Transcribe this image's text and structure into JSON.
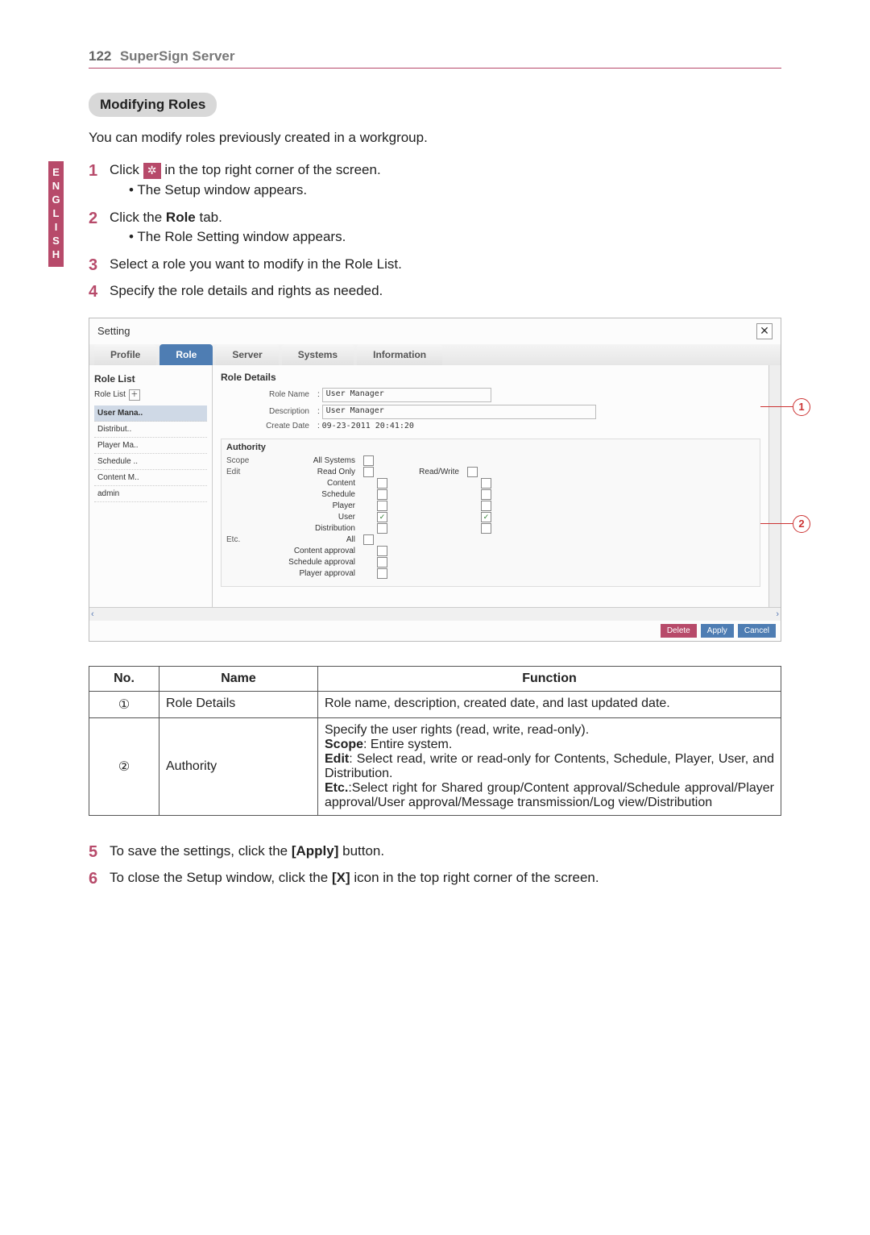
{
  "header": {
    "page_num": "122",
    "title": "SuperSign Server"
  },
  "side_tab": "ENGLISH",
  "section_title": "Modifying Roles",
  "intro": "You can modify roles previously created in a workgroup.",
  "steps": {
    "s1_a": "Click",
    "s1_b": "in the top right corner of the screen.",
    "s1_bullet": "The Setup window appears.",
    "s2": "Click the ",
    "s2_bold": "Role",
    "s2_tail": " tab.",
    "s2_bullet": "The Role Setting window appears.",
    "s3": "Select a role you want to modify in the Role List.",
    "s4": "Specify the role details and rights as needed.",
    "s5_a": "To save the settings, click the ",
    "s5_bold": "[Apply]",
    "s5_b": " button.",
    "s6_a": "To close the Setup window, click the ",
    "s6_bold": "[X]",
    "s6_b": " icon in the top right corner of the screen."
  },
  "nums": {
    "1": "1",
    "2": "2",
    "3": "3",
    "4": "4",
    "5": "5",
    "6": "6"
  },
  "setting": {
    "title": "Setting",
    "tabs": {
      "profile": "Profile",
      "role": "Role",
      "server": "Server",
      "systems": "Systems",
      "information": "Information"
    },
    "role_list": {
      "header": "Role List",
      "label": "Role List",
      "items": [
        "User Mana..",
        "Distribut..",
        "Player Ma..",
        "Schedule ..",
        "Content M..",
        "admin"
      ]
    },
    "details": {
      "header": "Role Details",
      "labels": {
        "role_name": "Role Name",
        "description": "Description",
        "create_date": "Create Date"
      },
      "role_name": "User Manager",
      "description": "User Manager",
      "create_date": "09-23-2011 20:41:20"
    },
    "authority": {
      "header": "Authority",
      "cats": {
        "scope": "Scope",
        "edit": "Edit",
        "etc": "Etc."
      },
      "labels": {
        "all_systems": "All Systems",
        "read_only": "Read Only",
        "read_write": "Read/Write",
        "content": "Content",
        "schedule": "Schedule",
        "player": "Player",
        "user": "User",
        "distribution": "Distribution",
        "all": "All",
        "content_approval": "Content approval",
        "schedule_approval": "Schedule approval",
        "player_approval": "Player approval"
      }
    },
    "buttons": {
      "delete": "Delete",
      "apply": "Apply",
      "cancel": "Cancel"
    }
  },
  "callouts": {
    "c1": "1",
    "c2": "2"
  },
  "legend": {
    "headers": {
      "no": "No.",
      "name": "Name",
      "function": "Function"
    },
    "rows": [
      {
        "no": "①",
        "name": "Role Details",
        "function": "Role name, description, created date, and last updated date."
      },
      {
        "no": "②",
        "name": "Authority",
        "function_lines": {
          "l1": "Specify the user rights (read, write, read-only).",
          "l2_b": "Scope",
          "l2_t": ": Entire system.",
          "l3_b": "Edit",
          "l3_t": ": Select read, write or read-only for Contents, Schedule, Player, User, and Distribution.",
          "l4_b": "Etc.",
          "l4_t": ":Select right for Shared group/Content approval/Schedule approval/Player approval/User approval/Message transmission/Log view/Distribution"
        }
      }
    ]
  }
}
